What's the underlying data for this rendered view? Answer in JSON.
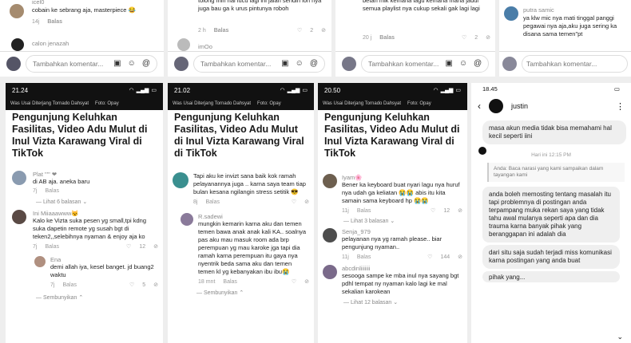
{
  "top_row": [
    {
      "user": "icel0",
      "comment": "cobain ke sebrang aja, masterpiece 😂",
      "time": "14j",
      "reply": "Balas",
      "likes": "",
      "commenter2": "calon jenazah",
      "placeholder": "Tambahkan komentar..."
    },
    {
      "user": "",
      "comment": "tolong min hal lucu lagi ini jalan sendiri loh nya juga bau ga k urus pintunya roboh",
      "time": "2 h",
      "reply": "Balas",
      "likes": "2",
      "commenter2": "imOo",
      "placeholder": "Tambahkan komentar..."
    },
    {
      "user": "",
      "comment": "betah mik kemana lagu kemana mana jadul semua playlist nya cukup sekali gak lagi lagi",
      "time": "20 j",
      "reply": "Balas",
      "likes": "2",
      "commenter2": "",
      "placeholder": "Tambahkan komentar..."
    },
    {
      "user": "putra samic",
      "comment": "ya klw mic nya mati tinggal panggi pegawai nya aja,aku juga sering ka disana sama temen\"pt",
      "time": "",
      "reply": "",
      "likes": "",
      "commenter2": "",
      "placeholder": "Tambahkan komentar..."
    }
  ],
  "phone1": {
    "time": "21.24",
    "news_bar": "Was Usai Diterjang Tornado Dahsyat",
    "photo": "Foto: Opay",
    "headline": "Pengunjung Keluhkan Fasilitas, Video Adu Mulut di Inul Vizta Karawang Viral di TikTok",
    "c1_user": "Plat \"'\" ❤",
    "c1_text": "di AB aja. aneka baru",
    "c1_time": "7j",
    "c1_reply": "Balas",
    "more1": "Lihat 6 balasan",
    "c2_user": "Ini Miiaaawww😼",
    "c2_text": "Kalo ke Vizta suka pesen yg small,tpi kdng suka dapetin remote yg susah bgt di teken2,,selebihnya nyaman & enjoy aja ko",
    "c2_time": "7j",
    "c2_reply": "Balas",
    "c2_likes": "12",
    "c3_user": "Ena",
    "c3_text": "demi allah iya, kesel banget. jd buang2 waktu",
    "c3_time": "7j",
    "c3_reply": "Balas",
    "c3_likes": "5",
    "hide": "Sembunyikan"
  },
  "phone2": {
    "time": "21.02",
    "news_bar": "Was Usai Diterjang Tornado Dahsyat",
    "photo": "Foto: Opay",
    "headline": "Pengunjung Keluhkan Fasilitas, Video Adu Mulut di Inul Vizta Karawang Viral di TikTok",
    "c1_text": "Tapi aku ke invizt sana baik kok ramah pelayanannya juga .. karna saya team tiap bulan kesana ngilangin stress setitik 😎",
    "c1_time": "8j",
    "c1_reply": "Balas",
    "c1_likes": "",
    "c2_user": "R.sadewi",
    "c2_text": "mungkin kemarin karna aku dan temen temen bawa anak anak kali KA.. soalnya pas aku mau masuk room ada brp perempuan yg mau karoke jga tapi dia ramah karna perempuan itu gaya nya nyentrik beda sama aku dan temen temen kl yg kebanyakan ibu ibu😭",
    "c2_time": "18 mnt",
    "c2_reply": "Balas",
    "c2_likes": "",
    "hide": "Sembunyikan"
  },
  "phone3": {
    "time": "20.50",
    "news_bar": "Was Usai Diterjang Tornado Dahsyat",
    "photo": "Foto: Opay",
    "headline": "Pengunjung Keluhkan Fasilitas, Video Adu Mulut di Inul Vizta Karawang Viral di TikTok",
    "c1_user": "Iyam🌸",
    "c1_text": "Bener ka keyboard buat nyari lagu nya huruf nya udah ga keliatan 😭😭 abis itu kita samain sama keyboard hp 😭😭",
    "c1_time": "11j",
    "c1_reply": "Balas",
    "c1_likes": "12",
    "more1": "Lihat 3 balasan",
    "c2_user": "Senja_979",
    "c2_text": "pelayanan nya yg ramah please.. biar pengunjung nyaman..",
    "c2_time": "11j",
    "c2_reply": "Balas",
    "c2_likes": "144",
    "c3_user": "abcdinliiiiiii",
    "c3_text": "sesooga sampe ke mba inul nya sayang bgt pdhl tempat ny nyaman kalo lagi ke mal sekalian karokean",
    "c3_time": "",
    "c3_reply": "",
    "more2": "Lihat 12 balasan"
  },
  "chat": {
    "time": "18.45",
    "name": "justin",
    "menu": "⋮",
    "m1": "masa akun media tidak bisa memahami hal kecil seperti iini",
    "stamp": "Hari ini 12:15 PM",
    "reply_quote": "Anda: Baca narasi yang kami sampaikan dalam tayangan kami",
    "m2": "anda boleh memosting tentang masalah itu tapi problemnya di postingan anda terpampang muka rekan saya yang tidak tahu awal mulanya seperti apa dan dia trauma karna banyak pihak yang beranggapan ini adalah dia",
    "m3": "dari situ saja sudah terjadi miss komunikasi karna postingan yang anda buat",
    "m4": "pihak yang..."
  }
}
